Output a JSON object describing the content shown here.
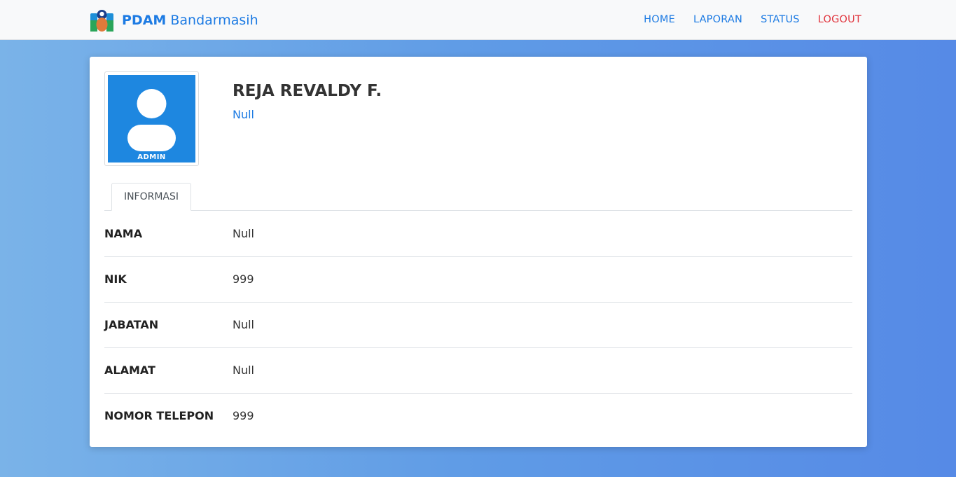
{
  "navbar": {
    "brand_bold": "PDAM",
    "brand_rest": "Bandarmasih",
    "links": [
      {
        "label": "HOME",
        "color": "#1d7be3"
      },
      {
        "label": "LAPORAN",
        "color": "#1d7be3"
      },
      {
        "label": "STATUS",
        "color": "#1d7be3"
      },
      {
        "label": "LOGOUT",
        "color": "#e0333c"
      }
    ]
  },
  "profile": {
    "avatar_caption": "ADMIN",
    "name": "REJA REVALDY F.",
    "subtitle": "Null"
  },
  "tabs": [
    {
      "label": "INFORMASI",
      "active": true
    }
  ],
  "info": [
    {
      "label": "NAMA",
      "value": "Null"
    },
    {
      "label": "NIK",
      "value": "999"
    },
    {
      "label": "JABATAN",
      "value": "Null"
    },
    {
      "label": "ALAMAT",
      "value": "Null"
    },
    {
      "label": "NOMOR TELEPON",
      "value": "999"
    }
  ],
  "colors": {
    "accent": "#1d7be3",
    "danger": "#e0333c",
    "avatar_bg": "#1e87e0"
  }
}
